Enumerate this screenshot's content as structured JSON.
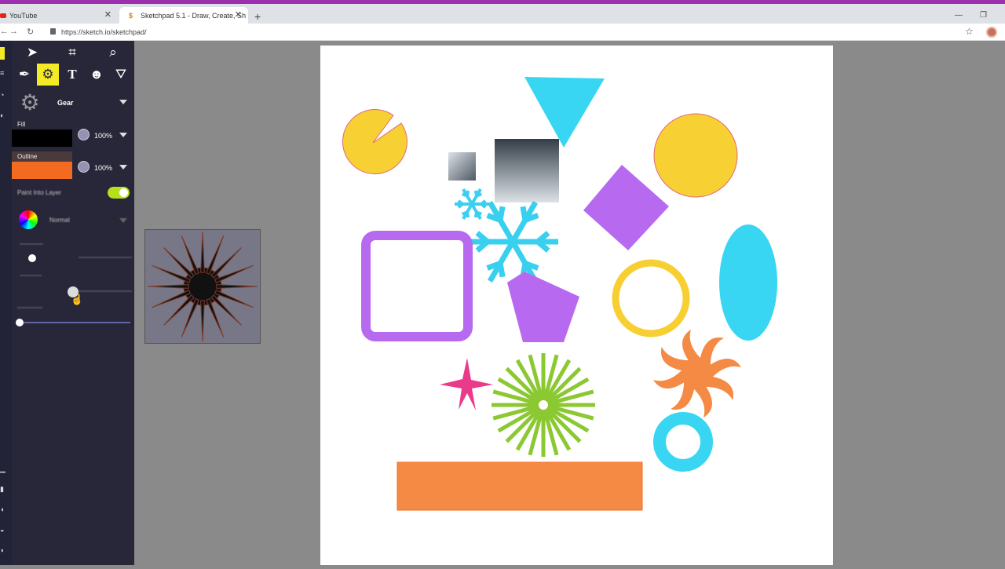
{
  "browser": {
    "tabs": [
      {
        "title": "YouTube",
        "active": false
      },
      {
        "title": "Sketchpad 5.1 - Draw, Create, Sh",
        "active": true
      }
    ],
    "url": "https://sketch.io/sketchpad/"
  },
  "tool": {
    "name": "Gear"
  },
  "fill": {
    "label": "Fill",
    "color": "#000000",
    "opacity": "100%"
  },
  "outline": {
    "label": "Outline",
    "color": "#f26b21",
    "opacity": "100%"
  },
  "options": {
    "paint_into_layer": "Paint Into Layer",
    "blend_mode": "Normal"
  },
  "colors": {
    "accent": "#f5ea26",
    "panel": "#272739"
  }
}
